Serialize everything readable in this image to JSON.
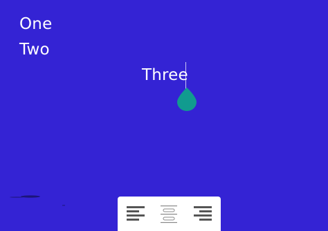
{
  "canvas": {
    "background": "#3423d4"
  },
  "text_lines": {
    "one": "One",
    "two": "Two",
    "three": "Three"
  },
  "selection_handle": {
    "color": "#119b8f"
  },
  "alignment_toolbar": {
    "options": [
      {
        "id": "left",
        "icon": "align-left-icon",
        "selected": false
      },
      {
        "id": "center",
        "icon": "align-center-icon",
        "selected": true
      },
      {
        "id": "right",
        "icon": "align-right-icon",
        "selected": false
      }
    ],
    "icon_color": "#555555"
  }
}
